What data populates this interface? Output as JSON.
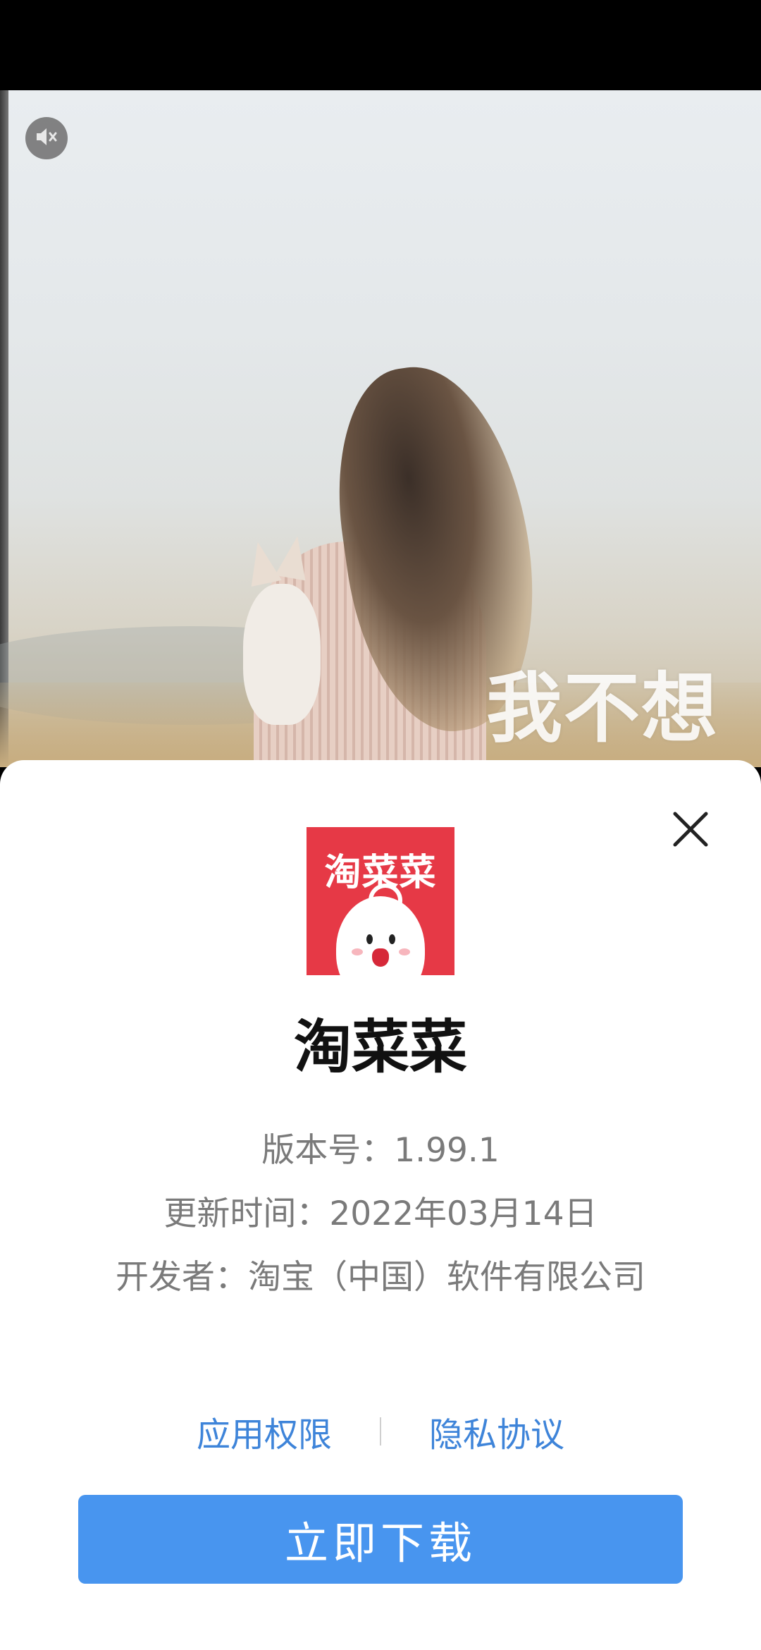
{
  "video": {
    "caption": "我不想",
    "mute_icon": "mute-speaker-icon"
  },
  "sheet": {
    "close_icon": "close-icon",
    "app_icon_text": "淘菜菜",
    "app_name": "淘菜菜",
    "version": "版本号：1.99.1",
    "updated": "更新时间：2022年03月14日",
    "developer": "开发者：淘宝（中国）软件有限公司",
    "permissions_link": "应用权限",
    "privacy_link": "隐私协议",
    "download_button": "立即下载",
    "colors": {
      "brand_red": "#e63946",
      "link_blue": "#3e84d9",
      "button_blue": "#4895ef"
    }
  }
}
